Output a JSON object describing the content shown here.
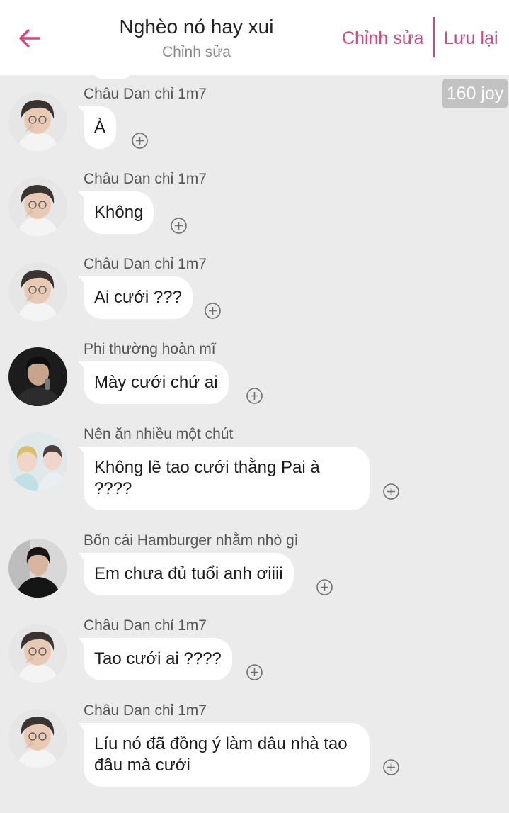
{
  "header": {
    "title": "Nghèo nó hay xui",
    "subtitle": "Chỉnh sửa",
    "edit_label": "Chỉnh sửa",
    "save_label": "Lưu lại",
    "accent_color": "#d6457f"
  },
  "joy_badge": "160 joy",
  "messages": [
    {
      "sender": "Châu Dan chỉ 1m7",
      "text": "À",
      "avatar": "avatar-chau-dan"
    },
    {
      "sender": "Châu Dan chỉ 1m7",
      "text": "Không",
      "avatar": "avatar-chau-dan"
    },
    {
      "sender": "Châu Dan chỉ 1m7",
      "text": "Ai cưới ???",
      "avatar": "avatar-chau-dan"
    },
    {
      "sender": "Phi thường hoàn mĩ",
      "text": "Mày cưới chứ ai",
      "avatar": "avatar-phi-thuong"
    },
    {
      "sender": "Nên ăn nhiều một chút",
      "text": "Không lẽ tao cưới thằng Pai à ????",
      "avatar": "avatar-nen-an"
    },
    {
      "sender": "Bốn cái Hamburger nhằm nhò gì",
      "text": "Em chưa đủ tuổi anh ơiiii",
      "avatar": "avatar-bon-cai"
    },
    {
      "sender": "Châu Dan chỉ 1m7",
      "text": "Tao cưới ai ????",
      "avatar": "avatar-chau-dan"
    },
    {
      "sender": "Châu Dan chỉ 1m7",
      "text": "Líu nó đã đồng ý làm dâu nhà tao đâu mà cưới",
      "avatar": "avatar-chau-dan"
    }
  ]
}
